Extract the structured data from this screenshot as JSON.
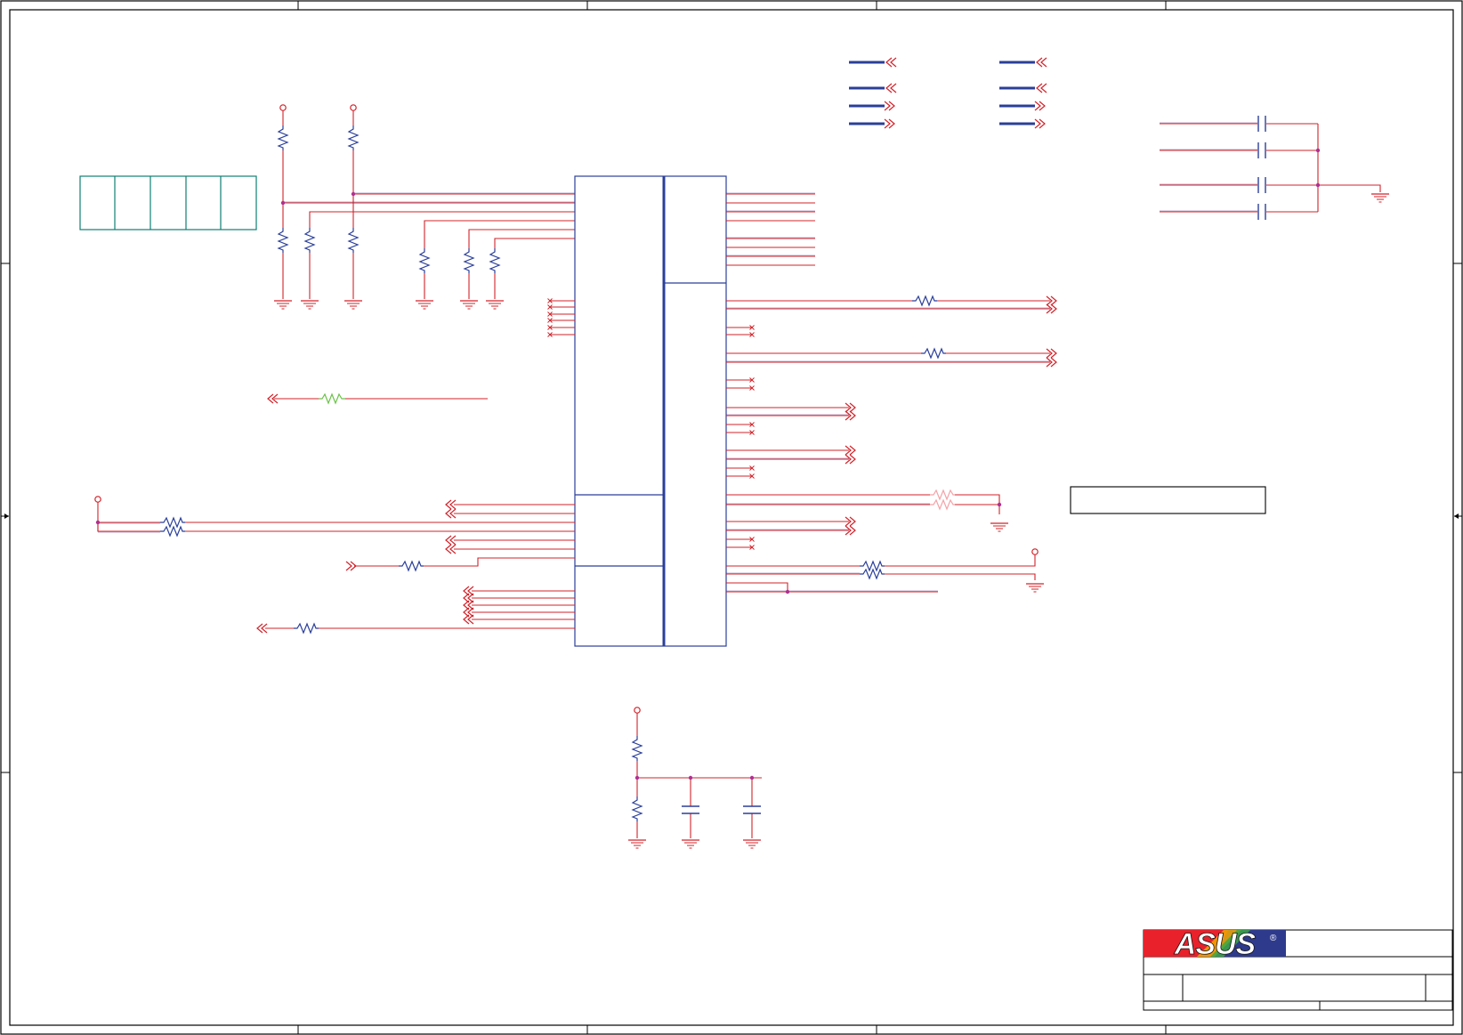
{
  "logo": {
    "brand": "ASUS",
    "registered_mark": "®",
    "colors": {
      "red": "#e8212b",
      "blue": "#2e3a8c",
      "white": "#ffffff"
    }
  },
  "colors": {
    "sheet_border": "#000000",
    "wire": "#d2232a",
    "bus": "#2b3f99",
    "component": "#2b3f99",
    "block_outline": "#2b3f99",
    "connector_table": "#0f7f73",
    "junction": "#b03090",
    "highlight_resistor": "#6cc24a"
  }
}
